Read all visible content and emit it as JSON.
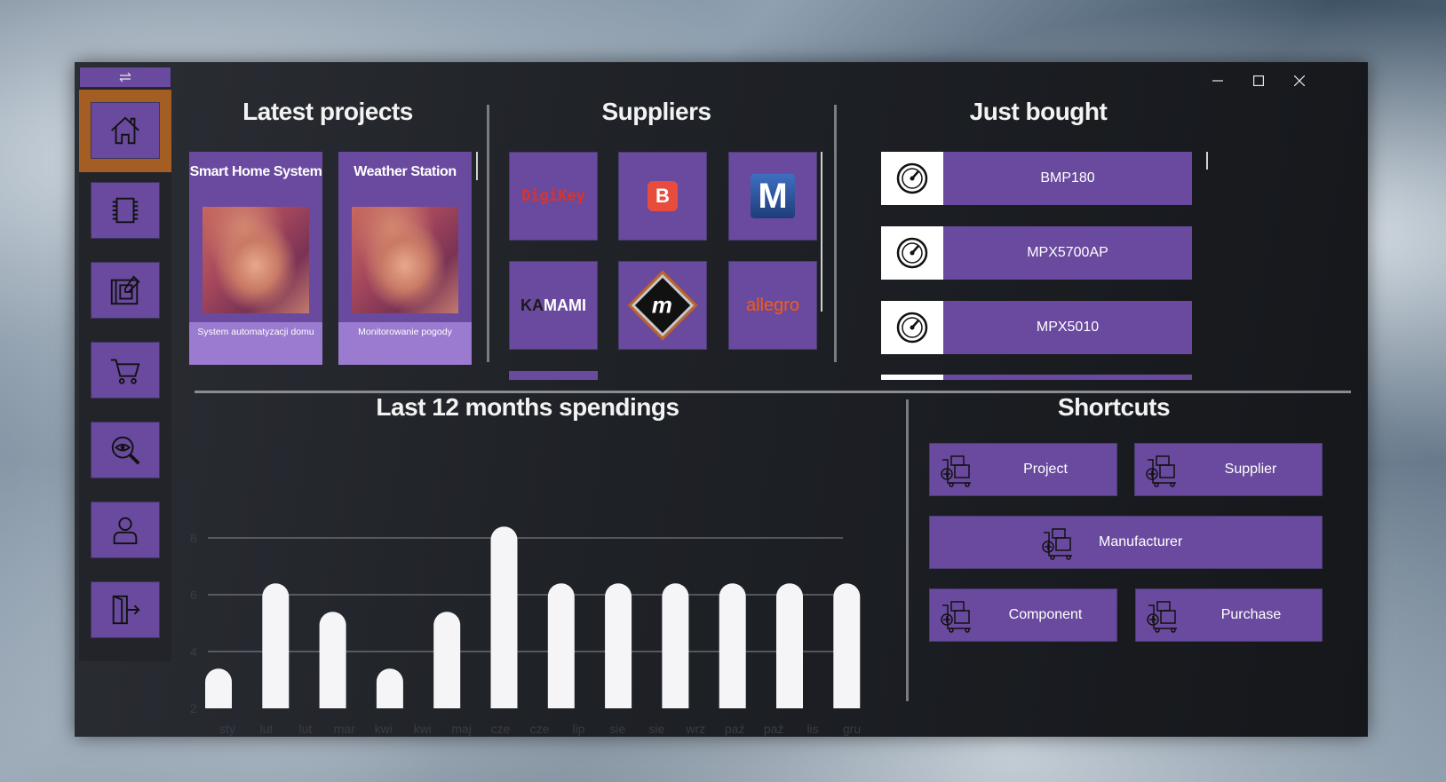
{
  "window": {
    "controls": [
      "minimize",
      "maximize",
      "close"
    ]
  },
  "sidebar": {
    "toggle_icon": "swap-arrows-icon",
    "items": [
      {
        "icon": "home-icon",
        "active": true
      },
      {
        "icon": "chip-icon",
        "active": false
      },
      {
        "icon": "blueprint-icon",
        "active": false
      },
      {
        "icon": "cart-icon",
        "active": false
      },
      {
        "icon": "eye-search-icon",
        "active": false
      },
      {
        "icon": "user-icon",
        "active": false
      },
      {
        "icon": "logout-icon",
        "active": false
      }
    ]
  },
  "latest_projects": {
    "title": "Latest projects",
    "items": [
      {
        "name": "Smart Home System",
        "description": "System automatyzacji domu"
      },
      {
        "name": "Weather Station",
        "description": "Monitorowanie pogody"
      }
    ]
  },
  "suppliers": {
    "title": "Suppliers",
    "items": [
      {
        "name": "DigiKey",
        "logo_text": "DigiKey",
        "color": "#d8352a"
      },
      {
        "name": "Botland",
        "logo_text": "B",
        "color": "#e74c3c"
      },
      {
        "name": "Mouser",
        "logo_text": "M",
        "color": "#1f3d7a"
      },
      {
        "name": "Kamami",
        "logo_text_dark": "KA",
        "logo_text_light": "MAMI",
        "color": "#1a1a1a"
      },
      {
        "name": "Microchip",
        "logo_text": "m",
        "color": "#111111"
      },
      {
        "name": "Allegro",
        "logo_text": "allegro",
        "color": "#ff5a00"
      }
    ]
  },
  "just_bought": {
    "title": "Just bought",
    "items": [
      {
        "name": "BMP180",
        "icon": "gauge-icon"
      },
      {
        "name": "MPX5700AP",
        "icon": "gauge-icon"
      },
      {
        "name": "MPX5010",
        "icon": "gauge-icon"
      }
    ]
  },
  "spendings": {
    "title": "Last 12 months spendings"
  },
  "chart_data": {
    "type": "bar",
    "categories": [
      "sty",
      "lut",
      "lut",
      "mar",
      "kwi",
      "kwi",
      "maj",
      "cze",
      "cze",
      "lip",
      "sie",
      "sie",
      "wrz",
      "paź",
      "paź",
      "lis",
      "gru"
    ],
    "bar_values": [
      3.4,
      6.4,
      5.4,
      3.4,
      5.4,
      8.4,
      6.4,
      6.4,
      6.4,
      6.4,
      6.4,
      6.4
    ],
    "y_ticks": [
      2,
      4,
      6,
      8
    ],
    "ylim": [
      2,
      8.5
    ],
    "grid": true,
    "bar_color": "#f5f5f7"
  },
  "shortcuts": {
    "title": "Shortcuts",
    "items": [
      {
        "label": "Project",
        "icon": "add-package-icon"
      },
      {
        "label": "Supplier",
        "icon": "add-package-icon"
      },
      {
        "label": "Manufacturer",
        "icon": "add-package-icon"
      },
      {
        "label": "Component",
        "icon": "add-package-icon"
      },
      {
        "label": "Purchase",
        "icon": "add-package-icon"
      }
    ]
  },
  "colors": {
    "accent": "#6a4a9e",
    "accent_light": "#9b7bcf",
    "active": "#a45d23",
    "text": "#f3f3f3"
  }
}
